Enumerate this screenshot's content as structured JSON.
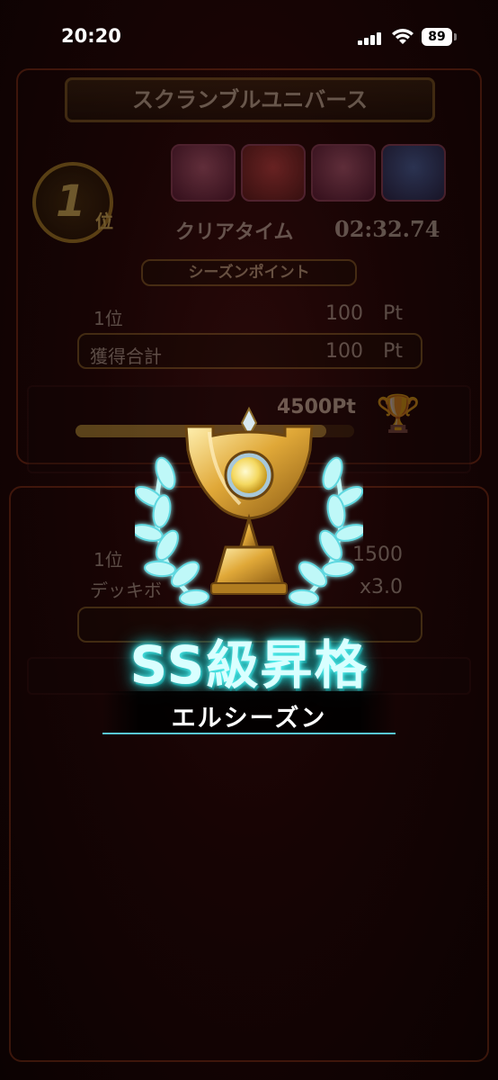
{
  "status_bar": {
    "time": "20:20",
    "battery": "89"
  },
  "background": {
    "title": "スクランブルユニバース",
    "rank": {
      "number": "1",
      "suffix": "位"
    },
    "clear_time_label": "クリアタイム",
    "clear_time_value": "02:32.74",
    "season_points_header": "シーズンポイント",
    "rows": [
      {
        "label": "1位",
        "value": "100",
        "unit": "Pt"
      },
      {
        "label": "獲得合計",
        "value": "100",
        "unit": "Pt"
      }
    ],
    "progress_text": "4500Pt",
    "progress_fraction": 0.9,
    "lower_rows": [
      {
        "label": "1位",
        "value": "1500"
      },
      {
        "label": "デッキボ",
        "value": "x3.0"
      }
    ]
  },
  "overlay": {
    "title": "SS級昇格",
    "season_name": "エルシーズン"
  },
  "colors": {
    "glow": "#66ffff",
    "gold": "#d8a030"
  }
}
